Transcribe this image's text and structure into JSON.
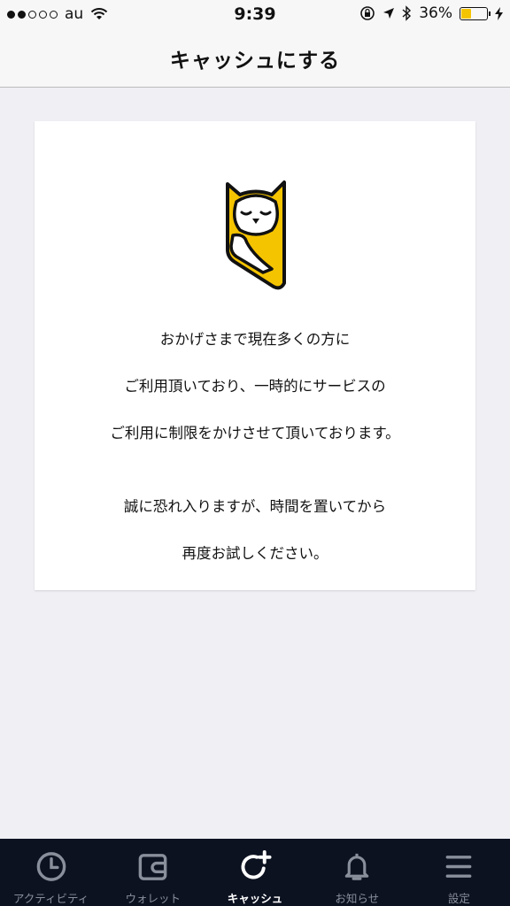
{
  "status_bar": {
    "carrier": "au",
    "time": "9:39",
    "battery_percent": "36%",
    "battery_level": 0.36
  },
  "nav": {
    "title": "キャッシュにする"
  },
  "card": {
    "message_lines": [
      "おかげさまで現在多くの方に",
      "ご利用頂いており、一時的にサービスの",
      "ご利用に制限をかけさせて頂いております。",
      "誠に恐れ入りますが、時間を置いてから",
      "再度お試しください。"
    ]
  },
  "tabs": [
    {
      "label": "アクティビティ",
      "icon": "clock-icon",
      "active": false
    },
    {
      "label": "ウォレット",
      "icon": "wallet-icon",
      "active": false
    },
    {
      "label": "キャッシュ",
      "icon": "cash-add-icon",
      "active": true
    },
    {
      "label": "お知らせ",
      "icon": "bell-icon",
      "active": false
    },
    {
      "label": "設定",
      "icon": "menu-icon",
      "active": false
    }
  ],
  "colors": {
    "brand_yellow": "#f5c400",
    "tab_bar_bg": "#0d1221",
    "tab_inactive": "#8a8f9c",
    "tab_active": "#ffffff"
  }
}
